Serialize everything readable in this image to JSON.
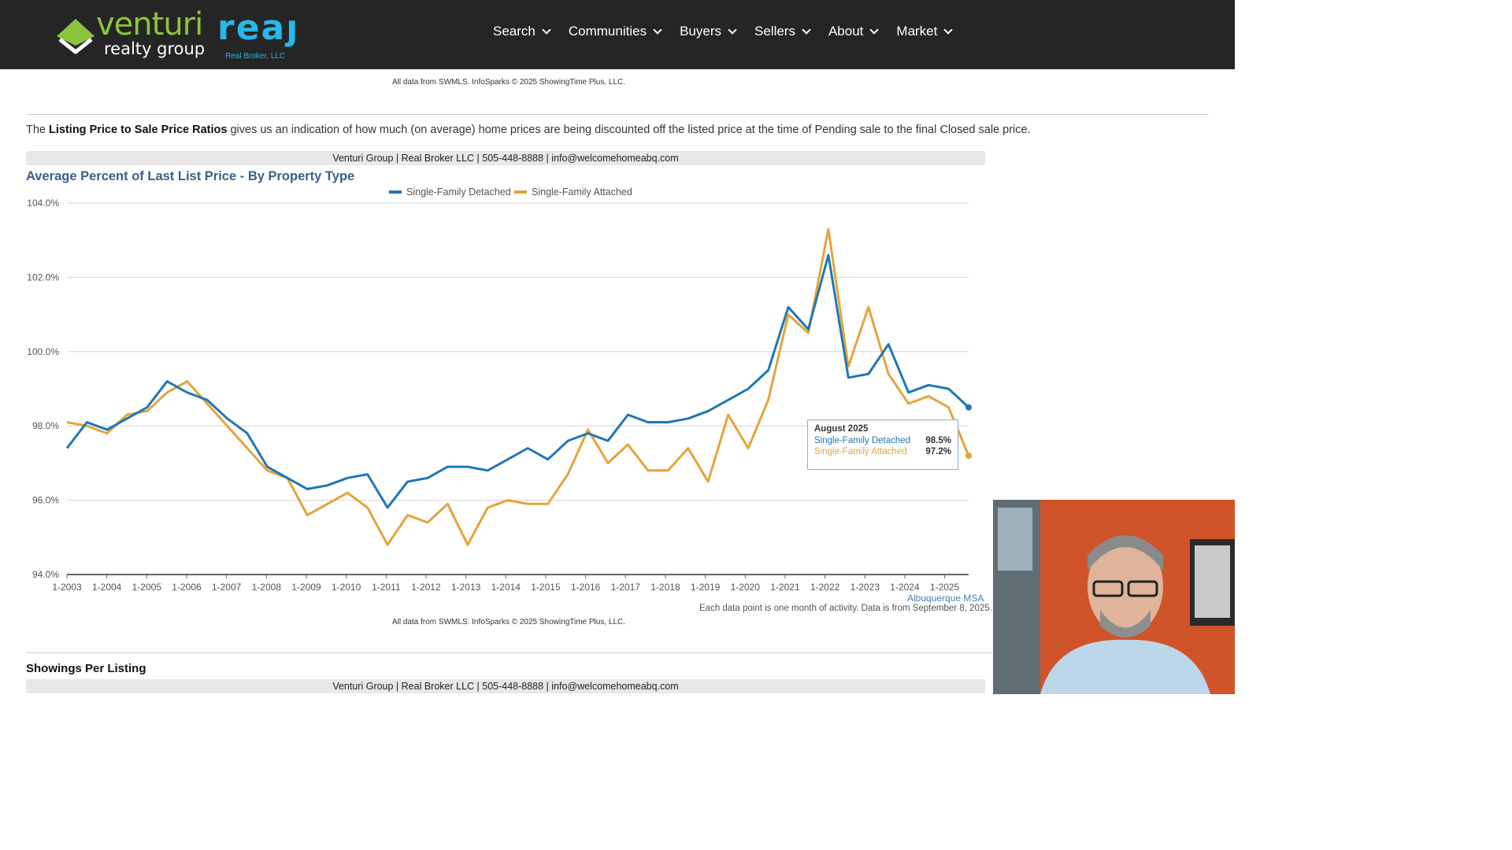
{
  "header": {
    "logo_main": "venturi",
    "logo_sub": "realty group",
    "logo_brand": "reaȷ",
    "logo_broker": "Real Broker, LLC",
    "nav": [
      {
        "label": "Search"
      },
      {
        "label": "Communities"
      },
      {
        "label": "Buyers"
      },
      {
        "label": "Sellers"
      },
      {
        "label": "About"
      },
      {
        "label": "Market"
      }
    ]
  },
  "top_source": "All data from SWMLS. InfoSparks © 2025 ShowingTime Plus, LLC.",
  "top_note": "Each data point is one month of activity. Data is from September 8, 2025.",
  "intro": {
    "prefix": "The ",
    "bold": "Listing Price to Sale Price Ratios",
    "suffix": " gives us an indication of how much (on average) home prices are being discounted off the listed price at the time of Pending sale to the final Closed sale price."
  },
  "banner": "Venturi Group | Real Broker LLC | 505-448-8888 | info@welcomehomeabq.com",
  "chart": {
    "title": "Average Percent of Last List Price - By Property Type",
    "region": "Albuquerque MSA",
    "note": "Each data point is one month of activity. Data is from September 8, 2025.",
    "source": "All data from SWMLS. InfoSparks © 2025 ShowingTime Plus, LLC."
  },
  "tooltip": {
    "title": "August 2025",
    "rows": [
      {
        "label": "Single-Family Detached",
        "value": "98.5%"
      },
      {
        "label": "Single-Family Attached",
        "value": "97.2%"
      }
    ]
  },
  "section_title": "Showings Per Listing",
  "colors": {
    "detached": "#1f77b4",
    "attached": "#e5a33b",
    "header_bg": "#252525",
    "title_blue": "#3b5f8a"
  },
  "chart_data": {
    "type": "line",
    "title": "Average Percent of Last List Price - By Property Type",
    "xlabel": "",
    "ylabel": "",
    "ylim": [
      94,
      104
    ],
    "yticks": [
      "94.0%",
      "96.0%",
      "98.0%",
      "100.0%",
      "102.0%",
      "104.0%"
    ],
    "ytick_values": [
      94,
      96,
      98,
      100,
      102,
      104
    ],
    "xticks": [
      "1-2003",
      "1-2004",
      "1-2005",
      "1-2006",
      "1-2007",
      "1-2008",
      "1-2009",
      "1-2010",
      "1-2011",
      "1-2012",
      "1-2013",
      "1-2014",
      "1-2015",
      "1-2016",
      "1-2017",
      "1-2018",
      "1-2019",
      "1-2020",
      "1-2021",
      "1-2022",
      "1-2023",
      "1-2024",
      "1-2025"
    ],
    "x": [
      "1-2003",
      "7-2003",
      "1-2004",
      "7-2004",
      "1-2005",
      "7-2005",
      "1-2006",
      "7-2006",
      "1-2007",
      "7-2007",
      "1-2008",
      "7-2008",
      "1-2009",
      "7-2009",
      "1-2010",
      "7-2010",
      "1-2011",
      "7-2011",
      "1-2012",
      "7-2012",
      "1-2013",
      "7-2013",
      "1-2014",
      "7-2014",
      "1-2015",
      "7-2015",
      "1-2016",
      "7-2016",
      "1-2017",
      "7-2017",
      "1-2018",
      "7-2018",
      "1-2019",
      "7-2019",
      "1-2020",
      "7-2020",
      "1-2021",
      "7-2021",
      "1-2022",
      "7-2022",
      "1-2023",
      "7-2023",
      "1-2024",
      "7-2024",
      "1-2025",
      "8-2025"
    ],
    "grid": true,
    "legend": "top",
    "series": [
      {
        "name": "Single-Family Detached",
        "values": [
          97.4,
          98.1,
          97.9,
          98.2,
          98.5,
          99.2,
          98.9,
          98.7,
          98.2,
          97.8,
          96.9,
          96.6,
          96.3,
          96.4,
          96.6,
          96.7,
          95.8,
          96.5,
          96.6,
          96.9,
          96.9,
          96.8,
          97.1,
          97.4,
          97.1,
          97.6,
          97.8,
          97.6,
          98.3,
          98.1,
          98.1,
          98.2,
          98.4,
          98.7,
          99.0,
          99.5,
          101.2,
          100.6,
          102.6,
          99.3,
          99.4,
          100.2,
          98.9,
          99.1,
          99.0,
          98.5
        ]
      },
      {
        "name": "Single-Family Attached",
        "values": [
          98.1,
          98.0,
          97.8,
          98.3,
          98.4,
          98.9,
          99.2,
          98.6,
          98.0,
          97.4,
          96.8,
          96.6,
          95.6,
          95.9,
          96.2,
          95.8,
          94.8,
          95.6,
          95.4,
          95.9,
          94.8,
          95.8,
          96.0,
          95.9,
          95.9,
          96.7,
          97.9,
          97.0,
          97.5,
          96.8,
          96.8,
          97.4,
          96.5,
          98.3,
          97.4,
          98.7,
          101.0,
          100.5,
          103.3,
          99.6,
          101.2,
          99.4,
          98.6,
          98.8,
          98.5,
          97.2
        ]
      }
    ]
  }
}
